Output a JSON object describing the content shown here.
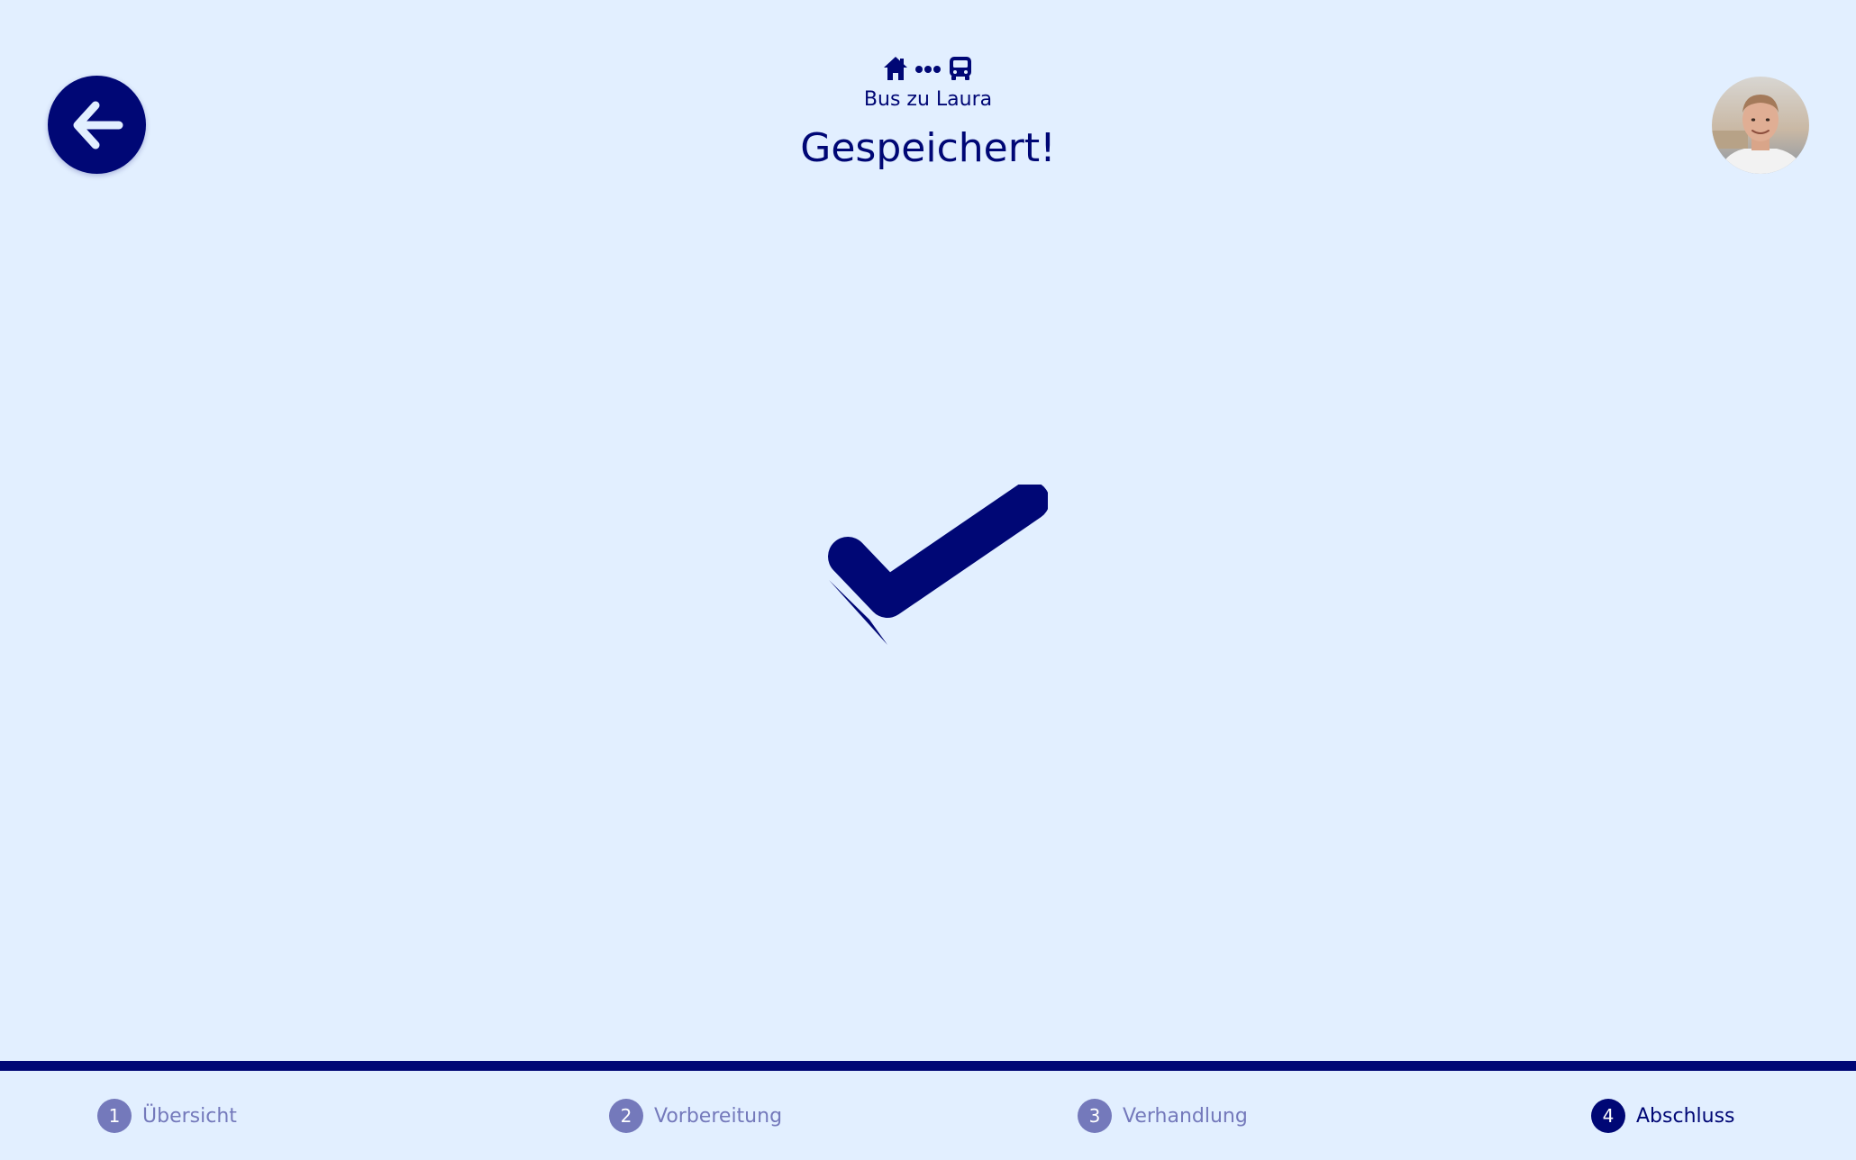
{
  "header": {
    "route_icons": [
      "home-icon",
      "dots-icon",
      "bus-icon"
    ],
    "route_label": "Bus zu Laura",
    "title": "Gespeichert!"
  },
  "back_button": {
    "icon": "arrow-left-icon"
  },
  "avatar": {
    "icon": "user-avatar"
  },
  "status_icon": "checkmark-icon",
  "steps": [
    {
      "number": "1",
      "label": "Übersicht",
      "active": false
    },
    {
      "number": "2",
      "label": "Vorbereitung",
      "active": false
    },
    {
      "number": "3",
      "label": "Verhandlung",
      "active": false
    },
    {
      "number": "4",
      "label": "Abschluss",
      "active": true
    }
  ],
  "colors": {
    "background": "#e2efff",
    "primary": "#000775",
    "inactive": "#7479bb"
  }
}
